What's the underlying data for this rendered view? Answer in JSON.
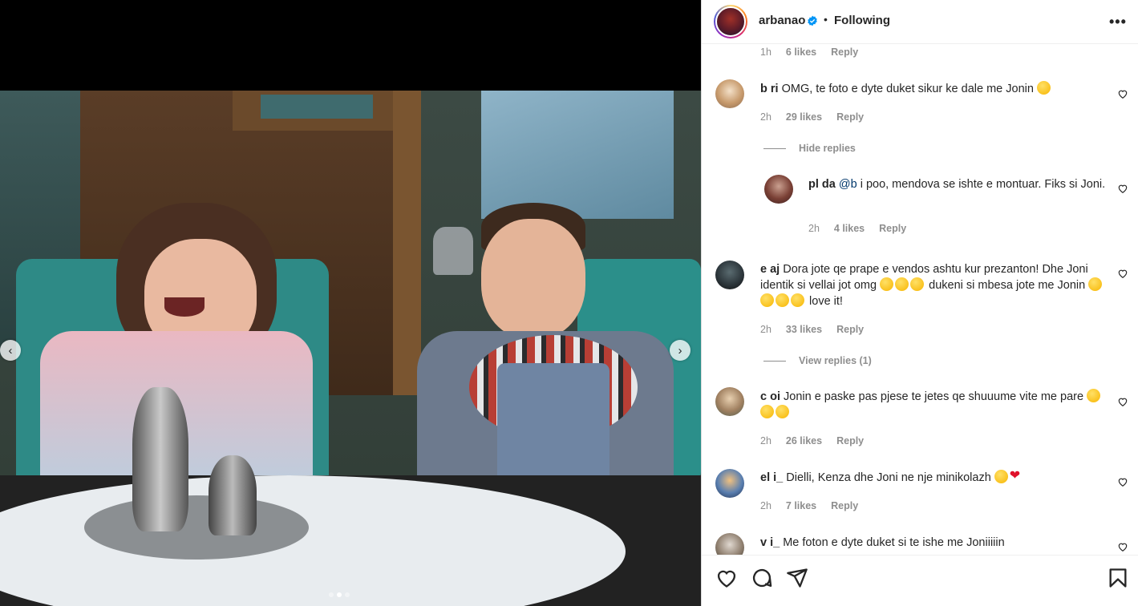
{
  "post": {
    "author": "arbanao",
    "verified": true,
    "separator": "•",
    "follow_status": "Following",
    "more_label": "•••",
    "photo_dots": 3,
    "active_photo": 1
  },
  "top_meta": {
    "time": "1h",
    "likes": "6 likes",
    "reply": "Reply"
  },
  "comments": [
    {
      "user": "b      ri",
      "text": "OMG, te foto e dyte duket sikur ke dale me Jonin",
      "time": "2h",
      "likes": "29 likes",
      "reply": "Reply",
      "toggle": "Hide replies",
      "replies": [
        {
          "user": "pl        da",
          "mention": "@b       ",
          "text": "i poo, mendova se ishte e montuar. Fiks si Joni.",
          "time": "2h",
          "likes": "4 likes",
          "reply": "Reply"
        }
      ]
    },
    {
      "user": "e                  aj",
      "text": "Dora jote qe prape e vendos ashtu kur prezanton! Dhe Joni identik si vellai jot omg",
      "text2": "dukeni si mbesa jote me Jonin",
      "text3": "love it!",
      "time": "2h",
      "likes": "33 likes",
      "reply": "Reply",
      "toggle": "View replies (1)"
    },
    {
      "user": "c      oi",
      "text": "Jonin e paske pas pjese te jetes qe shuuume vite me pare",
      "time": "2h",
      "likes": "26 likes",
      "reply": "Reply"
    },
    {
      "user": "el        i_",
      "text": "Dielli, Kenza dhe Joni ne nje minikolazh",
      "time": "2h",
      "likes": "7 likes",
      "reply": "Reply"
    },
    {
      "user": "v               i_",
      "text": "Me foton e dyte duket si te ishe me Joniiiiin"
    }
  ],
  "icons": {
    "like": "heart-icon",
    "comment": "comment-icon",
    "share": "share-icon",
    "save": "bookmark-icon",
    "prev": "chevron-left-icon",
    "next": "chevron-right-icon"
  },
  "colors": {
    "link": "#00376b",
    "muted": "#8e8e8e",
    "verified": "#0095f6",
    "heart": "#e0112b"
  }
}
